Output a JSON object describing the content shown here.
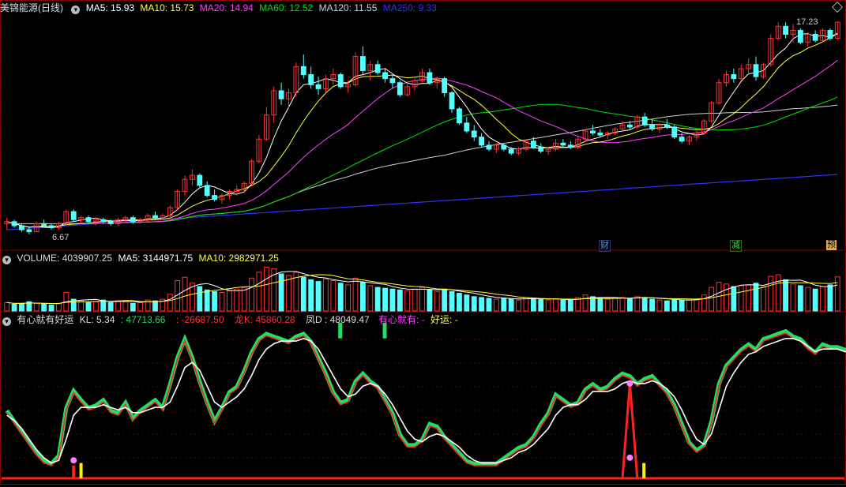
{
  "title": "美锦能源(日线)",
  "colors": {
    "up": "#ff3232",
    "down": "#54ffff",
    "ma5": "#ffffff",
    "ma10": "#ffff40",
    "ma20": "#ff40ff",
    "ma60": "#00e000",
    "ma120": "#d0d0d0",
    "ma250": "#3030ff",
    "kline_green": "#22dd66",
    "kline_red": "#ff2020",
    "kline_white": "#ffffff"
  },
  "price_legend": {
    "ma5": "MA5: 15.93",
    "ma10": "MA10: 15.73",
    "ma20": "MA20: 14.94",
    "ma60": "MA60: 12.52",
    "ma120": "MA120: 11.55",
    "ma250": "MA250: 9.33"
  },
  "high_label": "17.23",
  "low_label": "6.67",
  "events": [
    "财",
    "减",
    "预"
  ],
  "volume_legend": {
    "vol": "VOLUME: 4039907.25",
    "ma5": "MA5: 3144971.75",
    "ma10": "MA10: 2982971.25"
  },
  "ind_legend": {
    "name": "有心就有好运",
    "kl": "KL: 5.34",
    "v1": ": 47713.66",
    "v2": ": -26687.50",
    "lk_name": "龙K",
    "lk": ": 45860.28",
    "fd_name": "凤",
    "fd": "D : 48049.47",
    "yx": "有心就有: -",
    "hy": "好运: -"
  },
  "chart_data": [
    {
      "type": "candlestick",
      "title": "美锦能源(日线)",
      "ohlc": [
        [
          7.2,
          7.5,
          6.9,
          7.3
        ],
        [
          7.3,
          7.4,
          7.0,
          7.1
        ],
        [
          7.1,
          7.2,
          6.8,
          6.9
        ],
        [
          6.9,
          7.0,
          6.67,
          6.8
        ],
        [
          6.8,
          7.3,
          6.8,
          7.2
        ],
        [
          7.2,
          7.4,
          7.0,
          7.1
        ],
        [
          7.1,
          7.2,
          6.9,
          7.0
        ],
        [
          7.0,
          7.3,
          6.9,
          7.2
        ],
        [
          7.2,
          7.9,
          7.1,
          7.8
        ],
        [
          7.8,
          7.9,
          7.3,
          7.4
        ],
        [
          7.4,
          7.6,
          7.2,
          7.5
        ],
        [
          7.5,
          7.6,
          7.2,
          7.3
        ],
        [
          7.3,
          7.5,
          7.1,
          7.4
        ],
        [
          7.4,
          7.5,
          7.2,
          7.3
        ],
        [
          7.3,
          7.4,
          7.1,
          7.2
        ],
        [
          7.2,
          7.5,
          7.1,
          7.4
        ],
        [
          7.4,
          7.6,
          7.3,
          7.5
        ],
        [
          7.5,
          7.6,
          7.2,
          7.3
        ],
        [
          7.3,
          7.5,
          7.2,
          7.4
        ],
        [
          7.4,
          7.7,
          7.3,
          7.6
        ],
        [
          7.6,
          7.8,
          7.4,
          7.5
        ],
        [
          7.5,
          7.7,
          7.4,
          7.6
        ],
        [
          7.6,
          8.1,
          7.5,
          8.0
        ],
        [
          8.0,
          8.9,
          7.9,
          8.8
        ],
        [
          8.8,
          9.6,
          8.6,
          9.4
        ],
        [
          9.4,
          9.9,
          9.1,
          9.6
        ],
        [
          9.6,
          9.7,
          9.0,
          9.1
        ],
        [
          9.1,
          9.3,
          8.5,
          8.6
        ],
        [
          8.6,
          8.9,
          8.3,
          8.4
        ],
        [
          8.4,
          8.7,
          8.2,
          8.6
        ],
        [
          8.6,
          8.9,
          8.4,
          8.8
        ],
        [
          8.8,
          9.1,
          8.6,
          8.9
        ],
        [
          8.9,
          9.3,
          8.7,
          9.2
        ],
        [
          9.2,
          10.4,
          9.1,
          10.3
        ],
        [
          10.3,
          11.6,
          10.2,
          11.4
        ],
        [
          11.4,
          13.0,
          11.3,
          12.6
        ],
        [
          12.6,
          14.0,
          12.2,
          13.8
        ],
        [
          13.8,
          14.2,
          13.1,
          13.4
        ],
        [
          13.4,
          13.9,
          12.9,
          13.7
        ],
        [
          13.7,
          15.2,
          13.5,
          15.0
        ],
        [
          15.0,
          15.6,
          14.4,
          14.6
        ],
        [
          14.6,
          15.0,
          13.9,
          14.1
        ],
        [
          14.1,
          14.5,
          13.6,
          13.9
        ],
        [
          13.9,
          14.6,
          13.7,
          14.4
        ],
        [
          14.4,
          14.9,
          14.1,
          14.6
        ],
        [
          14.6,
          14.7,
          13.9,
          14.0
        ],
        [
          14.0,
          14.3,
          13.7,
          14.1
        ],
        [
          14.1,
          15.7,
          14.0,
          15.5
        ],
        [
          15.5,
          16.0,
          14.6,
          14.8
        ],
        [
          14.8,
          15.3,
          14.3,
          15.1
        ],
        [
          15.1,
          15.3,
          14.6,
          14.7
        ],
        [
          14.7,
          14.9,
          14.2,
          14.4
        ],
        [
          14.4,
          14.6,
          13.9,
          14.2
        ],
        [
          14.2,
          14.3,
          13.5,
          13.6
        ],
        [
          13.6,
          14.2,
          13.5,
          14.0
        ],
        [
          14.0,
          14.4,
          13.8,
          14.3
        ],
        [
          14.3,
          14.9,
          14.2,
          14.7
        ],
        [
          14.7,
          14.9,
          14.1,
          14.2
        ],
        [
          14.2,
          14.5,
          13.9,
          14.4
        ],
        [
          14.4,
          14.5,
          13.5,
          13.7
        ],
        [
          13.7,
          13.8,
          12.7,
          12.9
        ],
        [
          12.9,
          13.0,
          12.1,
          12.2
        ],
        [
          12.2,
          12.5,
          11.7,
          11.8
        ],
        [
          11.8,
          12.1,
          11.3,
          11.5
        ],
        [
          11.5,
          11.7,
          11.0,
          11.1
        ],
        [
          11.1,
          11.3,
          10.8,
          10.9
        ],
        [
          10.9,
          11.2,
          10.7,
          11.1
        ],
        [
          11.1,
          11.2,
          10.8,
          10.9
        ],
        [
          10.9,
          11.0,
          10.6,
          10.7
        ],
        [
          10.7,
          11.0,
          10.6,
          10.9
        ],
        [
          10.9,
          11.4,
          10.8,
          11.3
        ],
        [
          11.3,
          11.5,
          10.9,
          11.0
        ],
        [
          11.0,
          11.2,
          10.7,
          10.8
        ],
        [
          10.8,
          11.0,
          10.6,
          10.9
        ],
        [
          10.9,
          11.4,
          10.8,
          11.2
        ],
        [
          11.2,
          11.4,
          11.0,
          11.1
        ],
        [
          11.1,
          11.3,
          10.9,
          11.0
        ],
        [
          11.0,
          11.5,
          10.9,
          11.4
        ],
        [
          11.4,
          11.9,
          11.3,
          11.8
        ],
        [
          11.8,
          12.1,
          11.6,
          11.7
        ],
        [
          11.7,
          11.9,
          11.5,
          11.6
        ],
        [
          11.6,
          11.8,
          11.4,
          11.7
        ],
        [
          11.7,
          12.0,
          11.6,
          11.9
        ],
        [
          11.9,
          12.3,
          11.8,
          12.1
        ],
        [
          12.1,
          12.3,
          11.9,
          12.0
        ],
        [
          12.0,
          12.6,
          11.9,
          12.5
        ],
        [
          12.5,
          12.7,
          12.0,
          12.1
        ],
        [
          12.1,
          12.4,
          11.8,
          11.9
        ],
        [
          11.9,
          12.2,
          11.7,
          12.1
        ],
        [
          12.1,
          12.4,
          11.9,
          12.0
        ],
        [
          12.0,
          12.1,
          11.4,
          11.5
        ],
        [
          11.5,
          11.7,
          11.2,
          11.3
        ],
        [
          11.3,
          11.6,
          11.1,
          11.5
        ],
        [
          11.5,
          11.8,
          11.3,
          11.7
        ],
        [
          11.7,
          12.4,
          11.6,
          12.3
        ],
        [
          12.3,
          13.3,
          12.2,
          13.2
        ],
        [
          13.2,
          14.4,
          13.1,
          14.2
        ],
        [
          14.2,
          14.8,
          14.0,
          14.6
        ],
        [
          14.6,
          14.9,
          14.2,
          14.4
        ],
        [
          14.4,
          15.1,
          14.3,
          14.9
        ],
        [
          14.9,
          15.4,
          14.6,
          15.1
        ],
        [
          15.1,
          15.5,
          14.3,
          14.5
        ],
        [
          14.5,
          15.2,
          14.4,
          15.1
        ],
        [
          15.1,
          16.6,
          15.0,
          16.4
        ],
        [
          16.4,
          17.2,
          16.3,
          17.0
        ],
        [
          17.0,
          17.2,
          16.4,
          16.6
        ],
        [
          16.6,
          17.1,
          16.2,
          16.8
        ],
        [
          16.8,
          16.9,
          16.1,
          16.2
        ],
        [
          16.2,
          16.7,
          16.0,
          16.6
        ],
        [
          16.6,
          16.8,
          16.2,
          16.3
        ],
        [
          16.3,
          16.9,
          16.2,
          16.8
        ],
        [
          16.8,
          16.9,
          16.3,
          16.4
        ],
        [
          16.4,
          17.23,
          16.3,
          17.2
        ]
      ],
      "ylim": [
        6.0,
        17.6
      ],
      "annotations": {
        "high": "17.23",
        "low": "6.67"
      }
    },
    {
      "type": "bar",
      "title": "VOLUME",
      "values": [
        1.0,
        0.8,
        0.9,
        1.1,
        0.9,
        0.8,
        0.7,
        0.9,
        2.2,
        1.4,
        1.2,
        1.0,
        1.1,
        1.3,
        1.0,
        1.2,
        1.1,
        0.9,
        1.0,
        1.3,
        1.2,
        1.4,
        2.0,
        3.6,
        4.0,
        3.3,
        2.9,
        2.5,
        2.3,
        2.2,
        2.4,
        2.6,
        2.8,
        3.9,
        4.6,
        5.2,
        5.0,
        4.4,
        4.2,
        4.6,
        4.0,
        3.7,
        3.5,
        3.8,
        3.6,
        3.3,
        3.1,
        3.9,
        3.4,
        3.0,
        2.8,
        2.7,
        2.6,
        2.5,
        2.4,
        2.6,
        2.8,
        2.5,
        2.3,
        2.6,
        2.3,
        2.1,
        1.9,
        1.7,
        1.6,
        1.5,
        1.4,
        1.5,
        1.4,
        1.3,
        1.6,
        1.5,
        1.4,
        1.3,
        1.4,
        1.3,
        1.3,
        1.6,
        1.9,
        1.7,
        1.5,
        1.4,
        1.5,
        1.6,
        1.5,
        1.7,
        1.6,
        1.4,
        1.3,
        1.2,
        1.4,
        1.3,
        1.3,
        1.4,
        1.9,
        2.8,
        3.4,
        3.2,
        2.9,
        3.0,
        3.1,
        3.3,
        2.9,
        4.1,
        4.3,
        3.7,
        3.2,
        3.0,
        2.8,
        2.6,
        2.9,
        3.1,
        4.04
      ]
    },
    {
      "type": "line",
      "title": "有心就有好运",
      "series": [
        {
          "name": "龙K",
          "values": [
            -10,
            -18,
            -26,
            -34,
            -42,
            -48,
            -50,
            -44,
            -8,
            5,
            -2,
            -8,
            -6,
            -2,
            -10,
            -12,
            -4,
            -16,
            -10,
            -6,
            -2,
            -8,
            10,
            30,
            44,
            30,
            12,
            -4,
            -18,
            -8,
            4,
            8,
            20,
            34,
            44,
            48,
            46,
            44,
            42,
            46,
            48,
            42,
            30,
            18,
            4,
            -4,
            -2,
            12,
            18,
            12,
            8,
            -2,
            -12,
            -28,
            -36,
            -36,
            -32,
            -20,
            -22,
            -30,
            -36,
            -42,
            -48,
            -50,
            -50,
            -50,
            -50,
            -46,
            -42,
            -38,
            -36,
            -30,
            -20,
            -12,
            2,
            -2,
            -6,
            -4,
            6,
            10,
            6,
            8,
            14,
            18,
            16,
            10,
            14,
            16,
            10,
            4,
            -6,
            -20,
            -34,
            -40,
            -36,
            -18,
            10,
            24,
            30,
            36,
            40,
            36,
            44,
            46,
            48,
            50,
            46,
            44,
            38,
            34,
            40,
            38,
            38,
            36,
            36
          ]
        },
        {
          "name": "凤D",
          "values": [
            -12,
            -16,
            -22,
            -30,
            -38,
            -44,
            -48,
            -46,
            -30,
            -12,
            -6,
            -6,
            -6,
            -4,
            -6,
            -8,
            -6,
            -10,
            -10,
            -8,
            -6,
            -6,
            -2,
            10,
            24,
            28,
            22,
            10,
            -2,
            -6,
            -2,
            2,
            8,
            18,
            30,
            38,
            42,
            44,
            44,
            44,
            46,
            44,
            38,
            28,
            18,
            8,
            2,
            4,
            10,
            12,
            10,
            4,
            -4,
            -14,
            -24,
            -30,
            -32,
            -28,
            -26,
            -28,
            -32,
            -36,
            -42,
            -46,
            -48,
            -48,
            -48,
            -46,
            -44,
            -40,
            -38,
            -34,
            -28,
            -22,
            -12,
            -6,
            -4,
            -4,
            0,
            6,
            6,
            6,
            8,
            12,
            14,
            12,
            12,
            14,
            12,
            8,
            2,
            -8,
            -20,
            -30,
            -34,
            -26,
            -8,
            10,
            20,
            28,
            34,
            36,
            40,
            42,
            44,
            46,
            46,
            44,
            40,
            36,
            38,
            38,
            38,
            36,
            36
          ]
        }
      ],
      "ylim": [
        -56,
        56
      ]
    }
  ]
}
